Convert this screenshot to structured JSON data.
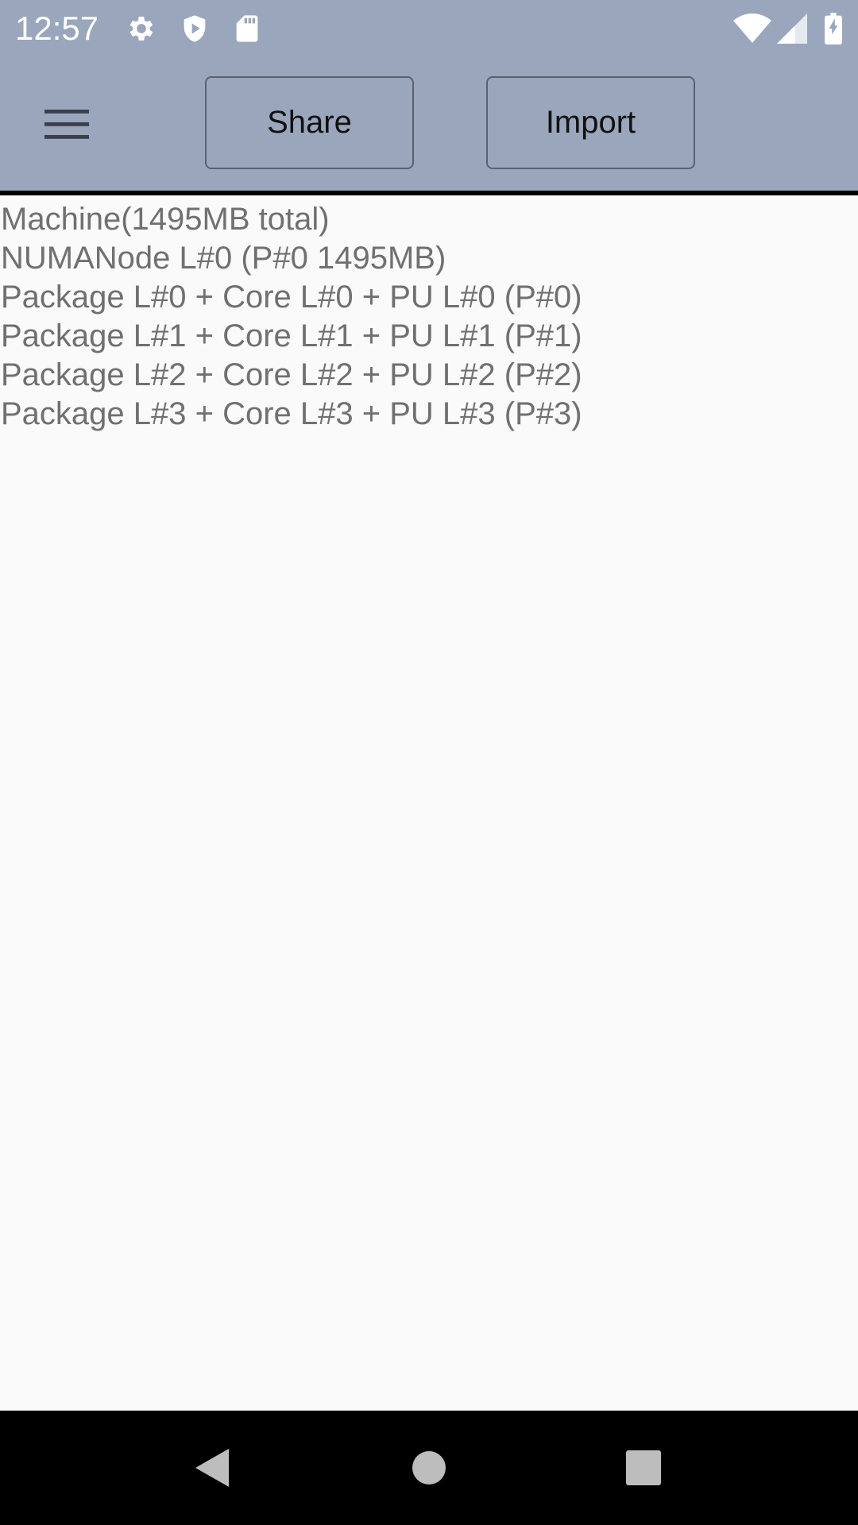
{
  "status_bar": {
    "time": "12:57",
    "left_icons": [
      "gear-icon",
      "shield-play-icon",
      "sd-card-icon"
    ],
    "right_icons": [
      "wifi-icon",
      "cell-signal-icon",
      "battery-icon"
    ]
  },
  "toolbar": {
    "menu_icon": "hamburger-menu-icon",
    "share_label": "Share",
    "import_label": "Import"
  },
  "content": {
    "lines": [
      "Machine(1495MB total)",
      "NUMANode L#0 (P#0 1495MB)",
      "Package L#0 + Core L#0 + PU L#0 (P#0)",
      "Package L#1 + Core L#1 + PU L#1 (P#1)",
      "Package L#2 + Core L#2 + PU L#2 (P#2)",
      "Package L#3 + Core L#3 + PU L#3 (P#3)"
    ]
  },
  "nav_bar": {
    "back_icon": "back-triangle-icon",
    "home_icon": "home-circle-icon",
    "recents_icon": "recents-square-icon"
  },
  "colors": {
    "toolbar_bg": "#9aa6bb",
    "content_bg": "#fafafa",
    "text": "#707070",
    "nav_bg": "#000000"
  }
}
